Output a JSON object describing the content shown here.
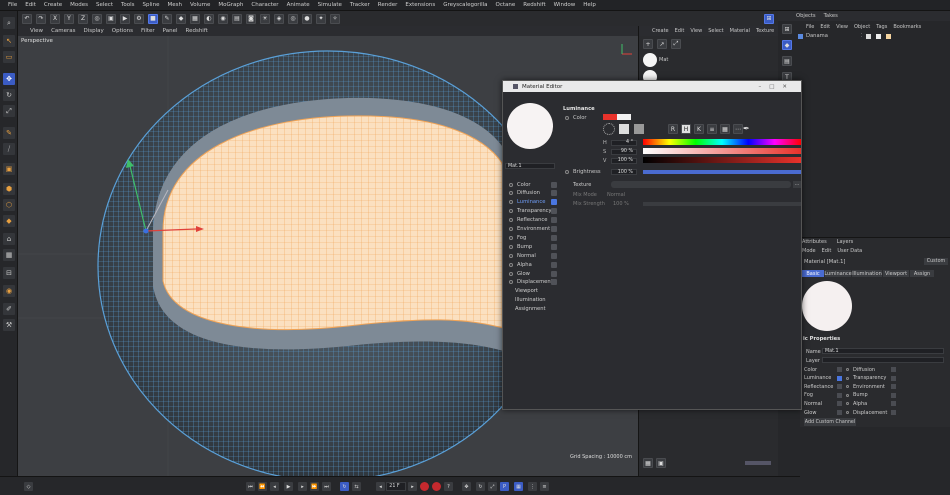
{
  "menu": [
    "File",
    "Edit",
    "Create",
    "Modes",
    "Select",
    "Tools",
    "Spline",
    "Mesh",
    "Volume",
    "MoGraph",
    "Character",
    "Animate",
    "Simulate",
    "Tracker",
    "Render",
    "Extensions",
    "Greyscalegorilla",
    "Octane",
    "Redshift",
    "Window",
    "Help"
  ],
  "axis_lock": {
    "x": "X",
    "y": "Y",
    "z": "Z"
  },
  "viewport": {
    "menu": [
      "View",
      "Cameras",
      "Display",
      "Options",
      "Filter",
      "Panel",
      "Redshift"
    ],
    "label": "Perspective",
    "grid_spacing": "Grid Spacing : 10000 cm"
  },
  "timeline": {
    "frame": "21 F"
  },
  "material_manager": {
    "menu": [
      "Create",
      "Edit",
      "View",
      "Select",
      "Material",
      "Texture"
    ],
    "mat_label": "Mat"
  },
  "objects": {
    "tabs": [
      "Objects",
      "Takes"
    ],
    "menu": [
      "File",
      "Edit",
      "View",
      "Object",
      "Tags",
      "Bookmarks"
    ],
    "item": "Danama"
  },
  "material_editor": {
    "title": "Material Editor",
    "mat_name": "Mat.1",
    "channels": [
      {
        "label": "Color",
        "on": false
      },
      {
        "label": "Diffusion",
        "on": false
      },
      {
        "label": "Luminance",
        "on": true
      },
      {
        "label": "Transparency",
        "on": false
      },
      {
        "label": "Reflectance",
        "on": false
      },
      {
        "label": "Environment",
        "on": false
      },
      {
        "label": "Fog",
        "on": false
      },
      {
        "label": "Bump",
        "on": false
      },
      {
        "label": "Normal",
        "on": false
      },
      {
        "label": "Alpha",
        "on": false
      },
      {
        "label": "Glow",
        "on": false
      },
      {
        "label": "Displacement",
        "on": false
      }
    ],
    "extras": [
      "Viewport",
      "Illumination",
      "Assignment"
    ],
    "section": "Luminance",
    "color_label": "Color",
    "h_label": "H",
    "h_value": "4 °",
    "s_label": "S",
    "s_value": "90 %",
    "v_label": "V",
    "v_value": "100 %",
    "brightness_label": "Brightness",
    "brightness_value": "100 %",
    "texture_label": "Texture",
    "mix_mode_label": "Mix Mode",
    "mix_mode_value": "Normal",
    "mix_strength_label": "Mix Strength",
    "mix_strength_value": "100 %",
    "color_swatch": "#e8322b"
  },
  "attributes": {
    "tabs": [
      "Attributes",
      "Layers"
    ],
    "menu": [
      "Mode",
      "Edit",
      "User Data"
    ],
    "title": "Material [Mat.1]",
    "custom": "Custom",
    "subtabs": [
      "Basic",
      "Luminance",
      "Illumination",
      "Viewport",
      "Assign"
    ],
    "props_title": "ic Properties",
    "name_label": "Name",
    "name_value": "Mat.1",
    "layer_label": "Layer",
    "left": [
      {
        "label": "Color",
        "on": false
      },
      {
        "label": "Luminance",
        "on": true
      },
      {
        "label": "Reflectance",
        "on": false
      },
      {
        "label": "Fog",
        "on": false
      },
      {
        "label": "Normal",
        "on": false
      },
      {
        "label": "Glow",
        "on": false
      }
    ],
    "right": [
      {
        "label": "Diffusion",
        "on": false
      },
      {
        "label": "Transparency",
        "on": false
      },
      {
        "label": "Environment",
        "on": false
      },
      {
        "label": "Bump",
        "on": false
      },
      {
        "label": "Alpha",
        "on": false
      },
      {
        "label": "Displacement",
        "on": false
      }
    ],
    "add_channel": "Add Custom Channel"
  },
  "colors": {
    "accent": "#4a76e0",
    "wire_outer": "#5aa0d8",
    "wire_inner": "#f0a356",
    "fill_inner": "#fbe0c0"
  }
}
